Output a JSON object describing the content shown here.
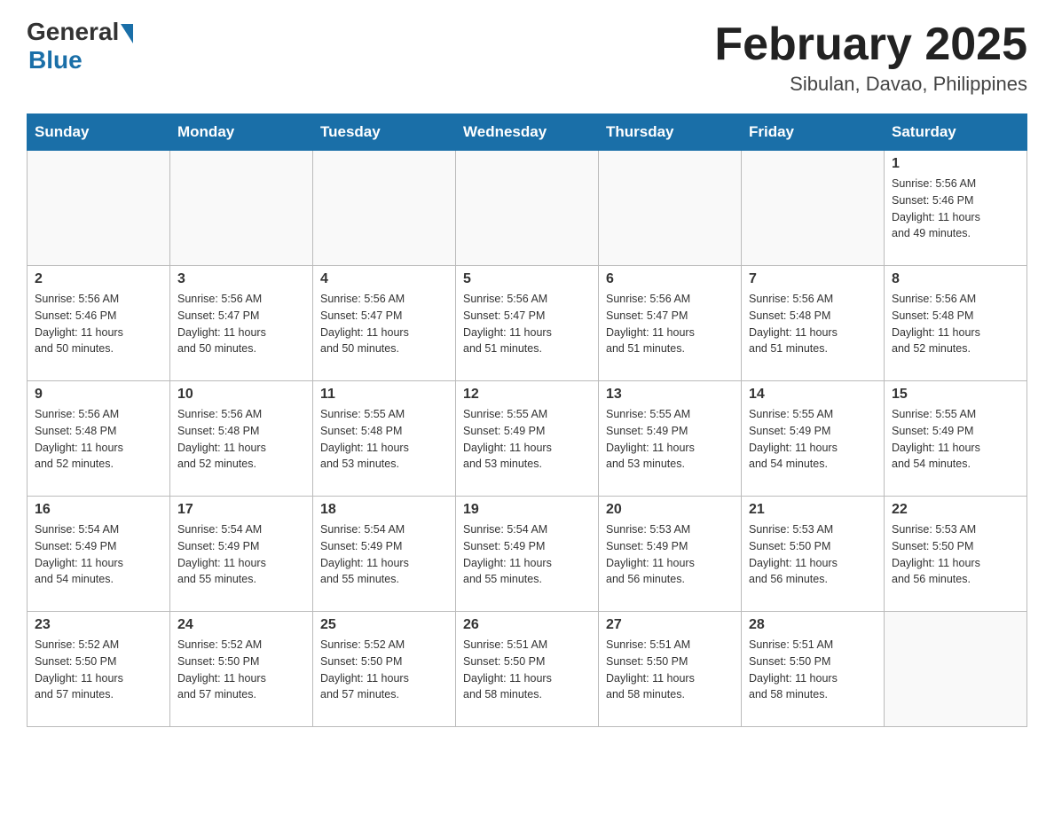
{
  "header": {
    "logo_general": "General",
    "logo_blue": "Blue",
    "month_title": "February 2025",
    "location": "Sibulan, Davao, Philippines"
  },
  "days_of_week": [
    "Sunday",
    "Monday",
    "Tuesday",
    "Wednesday",
    "Thursday",
    "Friday",
    "Saturday"
  ],
  "weeks": [
    {
      "days": [
        {
          "number": "",
          "info": ""
        },
        {
          "number": "",
          "info": ""
        },
        {
          "number": "",
          "info": ""
        },
        {
          "number": "",
          "info": ""
        },
        {
          "number": "",
          "info": ""
        },
        {
          "number": "",
          "info": ""
        },
        {
          "number": "1",
          "info": "Sunrise: 5:56 AM\nSunset: 5:46 PM\nDaylight: 11 hours\nand 49 minutes."
        }
      ]
    },
    {
      "days": [
        {
          "number": "2",
          "info": "Sunrise: 5:56 AM\nSunset: 5:46 PM\nDaylight: 11 hours\nand 50 minutes."
        },
        {
          "number": "3",
          "info": "Sunrise: 5:56 AM\nSunset: 5:47 PM\nDaylight: 11 hours\nand 50 minutes."
        },
        {
          "number": "4",
          "info": "Sunrise: 5:56 AM\nSunset: 5:47 PM\nDaylight: 11 hours\nand 50 minutes."
        },
        {
          "number": "5",
          "info": "Sunrise: 5:56 AM\nSunset: 5:47 PM\nDaylight: 11 hours\nand 51 minutes."
        },
        {
          "number": "6",
          "info": "Sunrise: 5:56 AM\nSunset: 5:47 PM\nDaylight: 11 hours\nand 51 minutes."
        },
        {
          "number": "7",
          "info": "Sunrise: 5:56 AM\nSunset: 5:48 PM\nDaylight: 11 hours\nand 51 minutes."
        },
        {
          "number": "8",
          "info": "Sunrise: 5:56 AM\nSunset: 5:48 PM\nDaylight: 11 hours\nand 52 minutes."
        }
      ]
    },
    {
      "days": [
        {
          "number": "9",
          "info": "Sunrise: 5:56 AM\nSunset: 5:48 PM\nDaylight: 11 hours\nand 52 minutes."
        },
        {
          "number": "10",
          "info": "Sunrise: 5:56 AM\nSunset: 5:48 PM\nDaylight: 11 hours\nand 52 minutes."
        },
        {
          "number": "11",
          "info": "Sunrise: 5:55 AM\nSunset: 5:48 PM\nDaylight: 11 hours\nand 53 minutes."
        },
        {
          "number": "12",
          "info": "Sunrise: 5:55 AM\nSunset: 5:49 PM\nDaylight: 11 hours\nand 53 minutes."
        },
        {
          "number": "13",
          "info": "Sunrise: 5:55 AM\nSunset: 5:49 PM\nDaylight: 11 hours\nand 53 minutes."
        },
        {
          "number": "14",
          "info": "Sunrise: 5:55 AM\nSunset: 5:49 PM\nDaylight: 11 hours\nand 54 minutes."
        },
        {
          "number": "15",
          "info": "Sunrise: 5:55 AM\nSunset: 5:49 PM\nDaylight: 11 hours\nand 54 minutes."
        }
      ]
    },
    {
      "days": [
        {
          "number": "16",
          "info": "Sunrise: 5:54 AM\nSunset: 5:49 PM\nDaylight: 11 hours\nand 54 minutes."
        },
        {
          "number": "17",
          "info": "Sunrise: 5:54 AM\nSunset: 5:49 PM\nDaylight: 11 hours\nand 55 minutes."
        },
        {
          "number": "18",
          "info": "Sunrise: 5:54 AM\nSunset: 5:49 PM\nDaylight: 11 hours\nand 55 minutes."
        },
        {
          "number": "19",
          "info": "Sunrise: 5:54 AM\nSunset: 5:49 PM\nDaylight: 11 hours\nand 55 minutes."
        },
        {
          "number": "20",
          "info": "Sunrise: 5:53 AM\nSunset: 5:49 PM\nDaylight: 11 hours\nand 56 minutes."
        },
        {
          "number": "21",
          "info": "Sunrise: 5:53 AM\nSunset: 5:50 PM\nDaylight: 11 hours\nand 56 minutes."
        },
        {
          "number": "22",
          "info": "Sunrise: 5:53 AM\nSunset: 5:50 PM\nDaylight: 11 hours\nand 56 minutes."
        }
      ]
    },
    {
      "days": [
        {
          "number": "23",
          "info": "Sunrise: 5:52 AM\nSunset: 5:50 PM\nDaylight: 11 hours\nand 57 minutes."
        },
        {
          "number": "24",
          "info": "Sunrise: 5:52 AM\nSunset: 5:50 PM\nDaylight: 11 hours\nand 57 minutes."
        },
        {
          "number": "25",
          "info": "Sunrise: 5:52 AM\nSunset: 5:50 PM\nDaylight: 11 hours\nand 57 minutes."
        },
        {
          "number": "26",
          "info": "Sunrise: 5:51 AM\nSunset: 5:50 PM\nDaylight: 11 hours\nand 58 minutes."
        },
        {
          "number": "27",
          "info": "Sunrise: 5:51 AM\nSunset: 5:50 PM\nDaylight: 11 hours\nand 58 minutes."
        },
        {
          "number": "28",
          "info": "Sunrise: 5:51 AM\nSunset: 5:50 PM\nDaylight: 11 hours\nand 58 minutes."
        },
        {
          "number": "",
          "info": ""
        }
      ]
    }
  ]
}
